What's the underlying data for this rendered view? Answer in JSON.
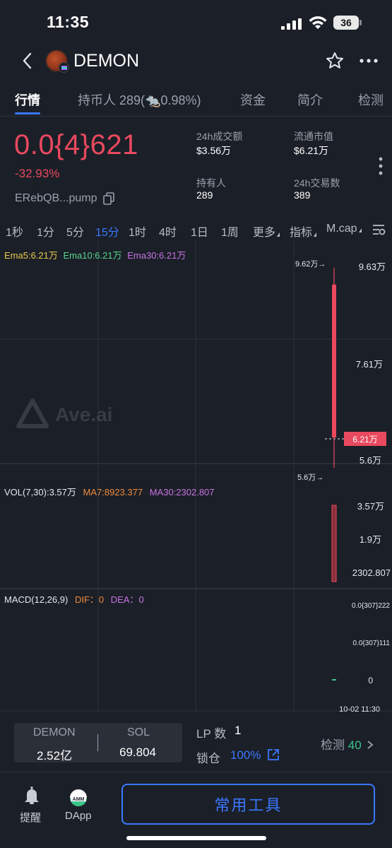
{
  "status": {
    "time": "11:35",
    "battery": "36"
  },
  "header": {
    "token_name": "DEMON"
  },
  "tabs": [
    {
      "label": "行情"
    },
    {
      "label": "持币人 289(🐀0.98%)"
    },
    {
      "label": "资金"
    },
    {
      "label": "简介"
    },
    {
      "label": "检测"
    }
  ],
  "price": {
    "value": "0.0{4}621",
    "change": "-32.93%",
    "address": "ERebQB...pump"
  },
  "stats": {
    "vol24h_label": "24h成交额",
    "vol24h_value": "$3.56万",
    "mcap_label": "流通市值",
    "mcap_value": "$6.21万",
    "holders_label": "持有人",
    "holders_value": "289",
    "tx24h_label": "24h交易数",
    "tx24h_value": "389"
  },
  "timeframes": [
    "1秒",
    "1分",
    "5分",
    "15分",
    "1时",
    "4时",
    "1日",
    "1周",
    "更多",
    "指标",
    "M.cap"
  ],
  "active_timeframe": "15分",
  "chart": {
    "ema": {
      "ema5": "Ema5:6.21万",
      "ema10": "Ema10:6.21万",
      "ema30": "Ema30:6.21万"
    },
    "high_marker": "9.62万→",
    "low_marker": "5.6万→",
    "y_ticks": [
      "9.63万",
      "7.61万",
      "5.6万"
    ],
    "current_price_tag": "6.21万",
    "watermark": "Ave.ai",
    "vol": {
      "label": "VOL(7,30):3.57万",
      "ma7": "MA7:8923.377",
      "ma30": "MA30:2302.807"
    },
    "vol_ticks": [
      "3.57万",
      "1.9万",
      "2302.807"
    ],
    "macd": {
      "label": "MACD(12,26,9)",
      "dif": "DIF：0",
      "dea": "DEA：0"
    },
    "macd_ticks": [
      "0.0{307}222",
      "0.0{307}111",
      "0"
    ],
    "x_label": "10-02 11:30",
    "colors": {
      "up": "#e9495e",
      "ema5": "#e6c84a",
      "ema10": "#58d68d",
      "ema30": "#c873e6",
      "ma7": "#f08a3c",
      "ma30": "#c873e6"
    }
  },
  "chart_data": {
    "type": "candlestick",
    "interval": "15分",
    "candles": [
      {
        "time": "10-02 11:30",
        "open": 56000,
        "high": 96200,
        "low": 56000,
        "close": 62100
      }
    ],
    "volume": [
      {
        "time": "10-02 11:30",
        "value": 35700
      }
    ],
    "macd": {
      "dif": 0,
      "dea": 0
    },
    "ylim": [
      56000,
      96300
    ]
  },
  "liquidity": {
    "token_label": "DEMON",
    "token_amount": "2.52亿",
    "sol_label": "SOL",
    "sol_amount": "69.804",
    "lp_label": "LP 数",
    "lp_value": "1",
    "lock_label": "锁仓",
    "lock_value": "100%",
    "detect_label": "检测",
    "detect_value": "40"
  },
  "bottom_nav": {
    "alert_label": "提醒",
    "dapp_label": "DApp",
    "tools_button": "常用工具"
  }
}
